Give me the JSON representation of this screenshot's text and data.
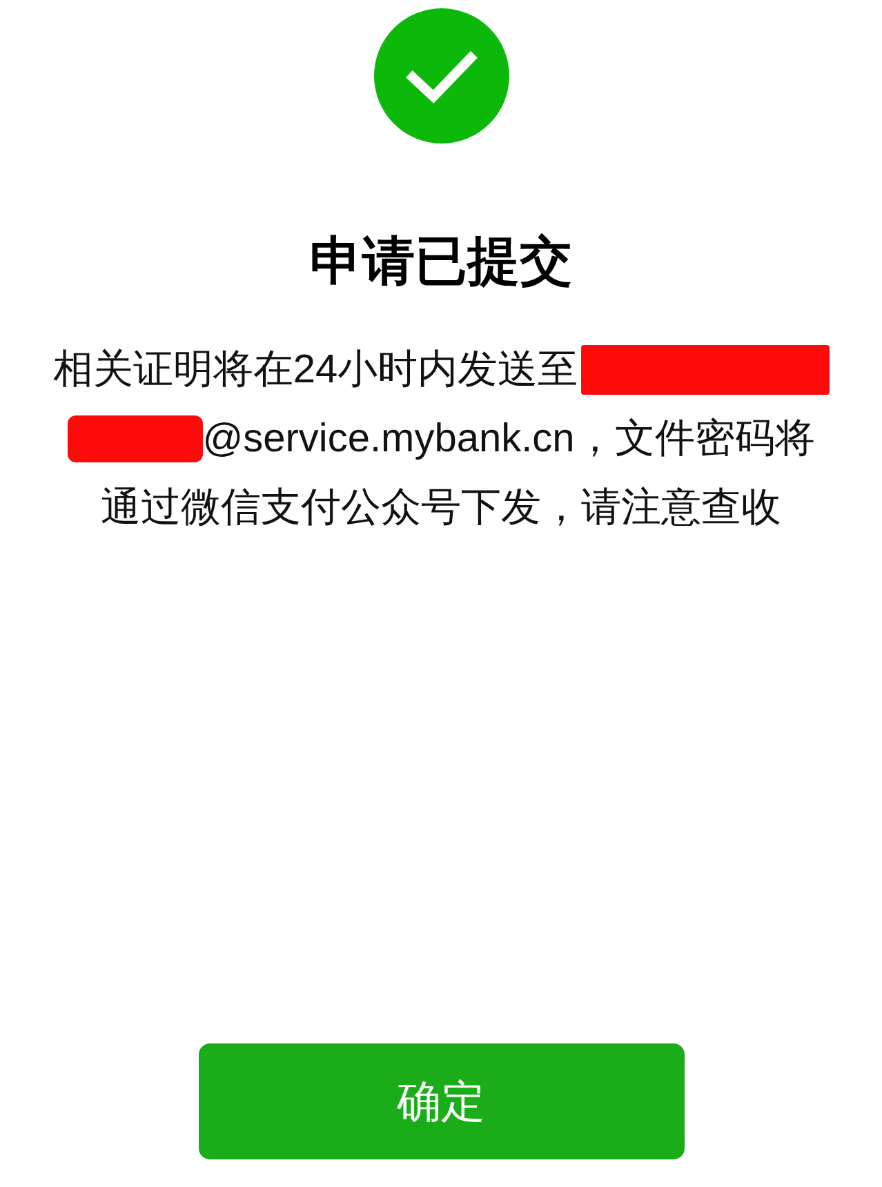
{
  "status_icon": {
    "kind": "success"
  },
  "title": "申请已提交",
  "message": {
    "lines": [
      [
        {
          "kind": "text",
          "text": "相关证明将在24小时内发送至"
        },
        {
          "kind": "redaction"
        }
      ],
      [
        {
          "kind": "redaction"
        },
        {
          "kind": "text",
          "text": "@service.mybank.cn，文件密码将"
        }
      ],
      [
        {
          "kind": "text",
          "text": "通过微信支付公众号下发，请注意查收"
        }
      ]
    ]
  },
  "button": {
    "label": "确定"
  }
}
